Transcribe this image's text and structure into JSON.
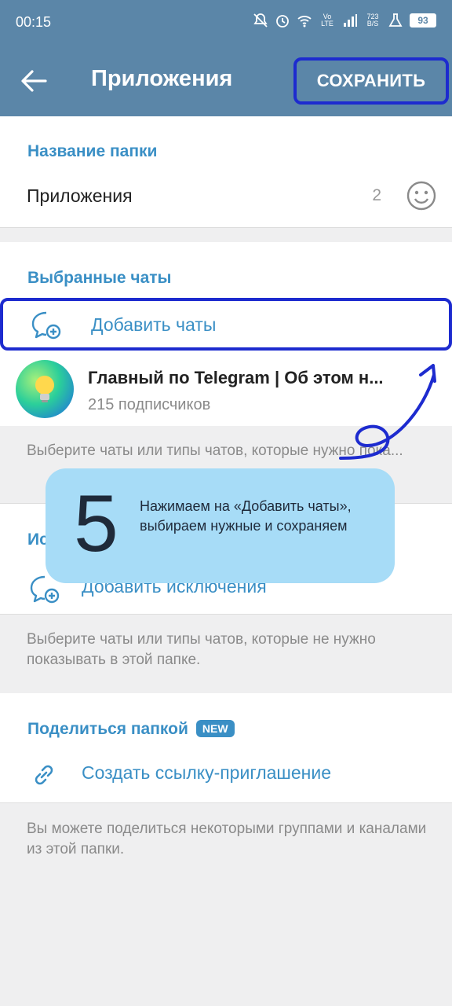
{
  "status_bar": {
    "time": "00:15",
    "speed_value": "723",
    "speed_unit": "B/S",
    "volte": "Vo LTE",
    "battery": "93"
  },
  "app_bar": {
    "title": "Приложения",
    "save_label": "СОХРАНИТЬ"
  },
  "folder_name": {
    "section_title": "Название папки",
    "value": "Приложения",
    "char_count": "2"
  },
  "selected_chats": {
    "section_title": "Выбранные чаты",
    "add_label": "Добавить чаты",
    "chats": [
      {
        "name": "Главный по Telegram | Об этом н...",
        "subtitle": "215 подписчиков"
      }
    ],
    "hint": "Выберите чаты или типы чатов, которые нужно пока..."
  },
  "exclusions": {
    "section_title": "Ис...",
    "add_label": "Добавить исключения",
    "hint": "Выберите чаты или типы чатов, которые не нужно показывать в этой папке."
  },
  "share": {
    "section_title": "Поделиться папкой",
    "badge": "NEW",
    "link_label": "Создать ссылку-приглашение",
    "hint": "Вы можете поделиться некоторыми группами и каналами из этой папки."
  },
  "callout": {
    "step": "5",
    "text": "Нажимаем на «Добавить чаты», выбираем нужные и сохраняем"
  },
  "colors": {
    "header": "#5b86a8",
    "accent": "#3a8fc5",
    "highlight": "#1d2bcf",
    "callout_bg": "#a7dcf7"
  }
}
